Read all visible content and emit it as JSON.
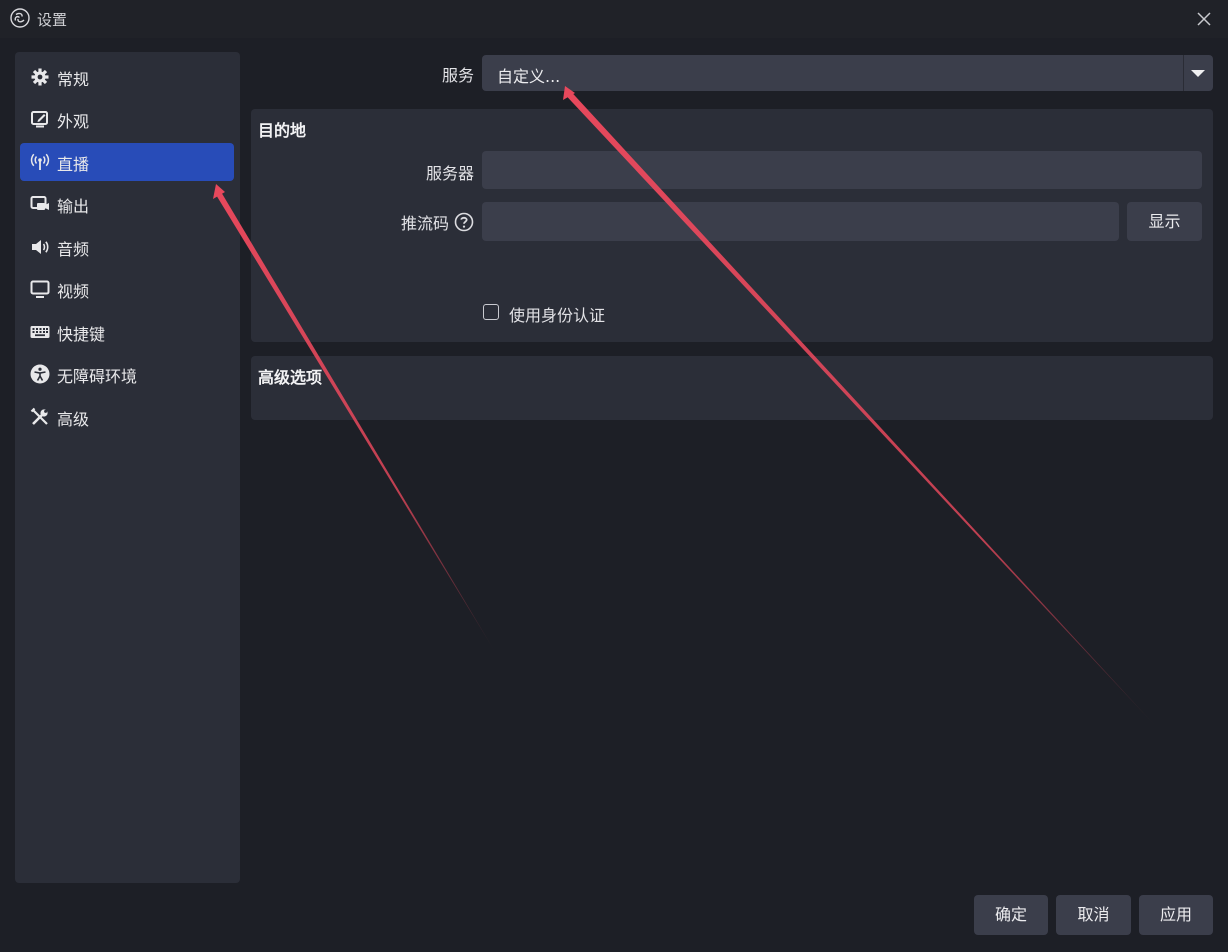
{
  "window": {
    "title": "设置"
  },
  "sidebar": {
    "items": [
      {
        "label": "常规",
        "icon": "gear-icon"
      },
      {
        "label": "外观",
        "icon": "appearance-icon"
      },
      {
        "label": "直播",
        "icon": "antenna-icon",
        "active": true
      },
      {
        "label": "输出",
        "icon": "output-icon"
      },
      {
        "label": "音频",
        "icon": "speaker-icon"
      },
      {
        "label": "视频",
        "icon": "monitor-icon"
      },
      {
        "label": "快捷键",
        "icon": "keyboard-icon"
      },
      {
        "label": "无障碍环境",
        "icon": "accessibility-icon"
      },
      {
        "label": "高级",
        "icon": "tools-icon"
      }
    ]
  },
  "stream": {
    "service_label": "服务",
    "service_value": "自定义...",
    "destination": {
      "title": "目的地",
      "server_label": "服务器",
      "server_value": "",
      "key_label": "推流码",
      "key_value": "",
      "show_button": "显示",
      "auth_label": "使用身份认证",
      "auth_checked": false
    },
    "advanced": {
      "title": "高级选项"
    }
  },
  "footer": {
    "ok": "确定",
    "cancel": "取消",
    "apply": "应用"
  },
  "colors": {
    "background": "#1d1f26",
    "panel": "#2b2e38",
    "field": "#3b3e4b",
    "accent": "#284cb8",
    "annotation_arrow": "#e8485c"
  }
}
